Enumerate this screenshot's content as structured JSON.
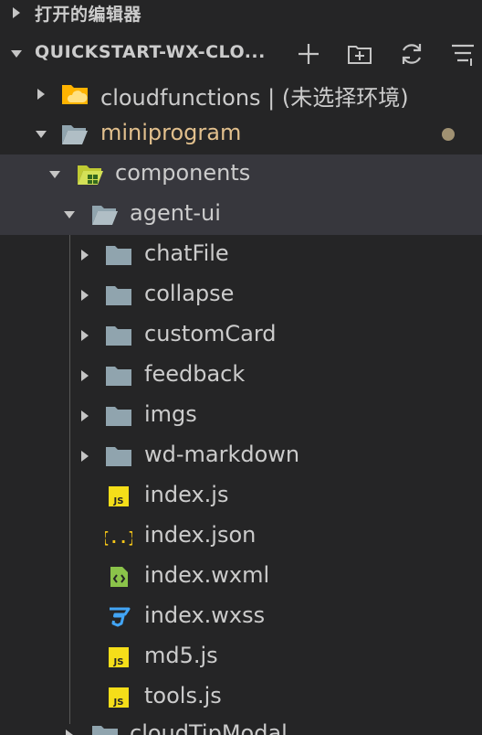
{
  "open_editors": {
    "title": "打开的编辑器"
  },
  "workspace": {
    "title": "QUICKSTART-WX-CLO..."
  },
  "tree": {
    "cloudfunctions": "cloudfunctions | (未选择环境)",
    "miniprogram": "miniprogram",
    "components": "components",
    "agent_ui": "agent-ui",
    "children": [
      {
        "label": "chatFile",
        "icon": "folder-icon"
      },
      {
        "label": "collapse",
        "icon": "folder-icon"
      },
      {
        "label": "customCard",
        "icon": "folder-icon"
      },
      {
        "label": "feedback",
        "icon": "folder-icon"
      },
      {
        "label": "imgs",
        "icon": "folder-icon"
      },
      {
        "label": "wd-markdown",
        "icon": "folder-icon"
      },
      {
        "label": "index.js",
        "icon": "js-file-icon"
      },
      {
        "label": "index.json",
        "icon": "json-file-icon"
      },
      {
        "label": "index.wxml",
        "icon": "wxml-file-icon"
      },
      {
        "label": "index.wxss",
        "icon": "css-file-icon"
      },
      {
        "label": "md5.js",
        "icon": "js-file-icon"
      },
      {
        "label": "tools.js",
        "icon": "js-file-icon"
      }
    ],
    "next": "cloudTipModal"
  },
  "colors": {
    "background": "#252526",
    "selected_row": "#37373d",
    "modified_label": "#e2c08d",
    "folder": "#90a4ae",
    "js_badge": "#f5de19",
    "json_braces": "#f5c518",
    "wxml": "#8bc34a",
    "css": "#42a5f5",
    "cloud_folder": "#ffb300",
    "modified_dot": "#a09172"
  }
}
